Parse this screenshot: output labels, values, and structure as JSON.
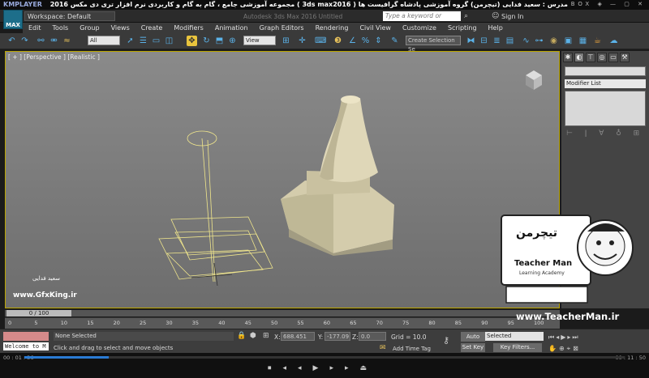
{
  "player": {
    "logo": "KMPLAYER",
    "title": "مجموعه آموزشی جامع ، گام به گام و کاربردی نرم افزار تری دی مکس 2016 ( 3ds max2016 )  مدرس : سعید فدایی (تیچرمن) گروه آموزشی پادشاه گرافیست ها",
    "controls": "BOX ◈ — ▢ ✕",
    "time_elapsed": "00 : 01 : 36",
    "time_total": "00 : 11 : 50",
    "progress": 0.14
  },
  "max": {
    "logo": "MAX",
    "workspace": "Workspace: Default",
    "document_title": "Autodesk 3ds Max 2016      Untitled",
    "search_placeholder": "Type a keyword or phrase",
    "sign_in": "Sign In"
  },
  "menubar": [
    "Edit",
    "Tools",
    "Group",
    "Views",
    "Create",
    "Modifiers",
    "Animation",
    "Graph Editors",
    "Rendering",
    "Civil View",
    "Customize",
    "Scripting",
    "Help"
  ],
  "toolbar": {
    "filter": "All",
    "ref_coord": "View",
    "selection_set": "Create Selection Se"
  },
  "viewport": {
    "label": "[ + ] [Perspective ] [Realistic ]"
  },
  "command_panel": {
    "modifier_list": "Modifier List"
  },
  "timeline": {
    "frame": "0 / 100",
    "ticks": [
      "0",
      "5",
      "10",
      "15",
      "20",
      "25",
      "30",
      "35",
      "40",
      "45",
      "50",
      "55",
      "60",
      "65",
      "70",
      "75",
      "80",
      "85",
      "90",
      "95",
      "100"
    ]
  },
  "status": {
    "welcome": "Welcome to M",
    "selection": "None Selected",
    "prompt": "Click and drag to select and move objects",
    "x_label": "X:",
    "x_value": "688.451",
    "y_label": "Y:",
    "y_value": "-177.09",
    "z_label": "Z:",
    "z_value": "0.0",
    "grid": "Grid = 10.0",
    "add_time_tag": "Add Time Tag",
    "auto_key": "Auto Key",
    "set_key": "Set Key",
    "selected": "Selected",
    "key_filters": "Key Filters..."
  },
  "watermark": {
    "signature": "سعید فدایی",
    "site": "www.GfxKing.ir",
    "teacher_site": "www.TeacherMan.ir",
    "teacher_logo_fa": "تیچرمن",
    "teacher_logo_en": "Teacher Man",
    "teacher_logo_sub": "Learning Academy"
  },
  "colors": {
    "viewport_border": "#bba500",
    "object": "#d8d0b0",
    "accent": "#2a7bd4"
  }
}
